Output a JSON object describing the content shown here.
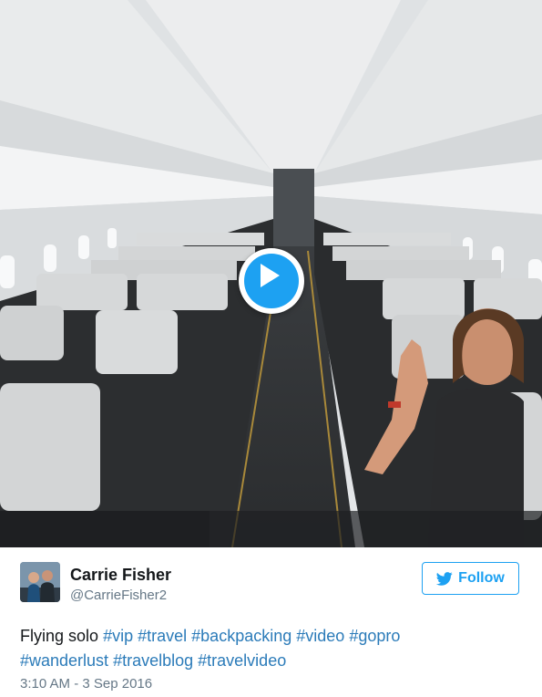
{
  "media": {
    "type": "video",
    "play_icon": "play-icon"
  },
  "author": {
    "name": "Carrie Fisher",
    "handle": "@CarrieFisher2",
    "avatar_icon": "avatar"
  },
  "follow": {
    "label": "Follow",
    "icon": "twitter-bird-icon",
    "color": "#1da1f2"
  },
  "tweet": {
    "text": "Flying solo",
    "hashtags": [
      "#vip",
      "#travel",
      "#backpacking",
      "#video",
      "#gopro",
      "#wanderlust",
      "#travelblog",
      "#travelvideo"
    ],
    "hashtag_color": "#2b7bb9"
  },
  "timestamp": "3:10 AM - 3 Sep 2016"
}
